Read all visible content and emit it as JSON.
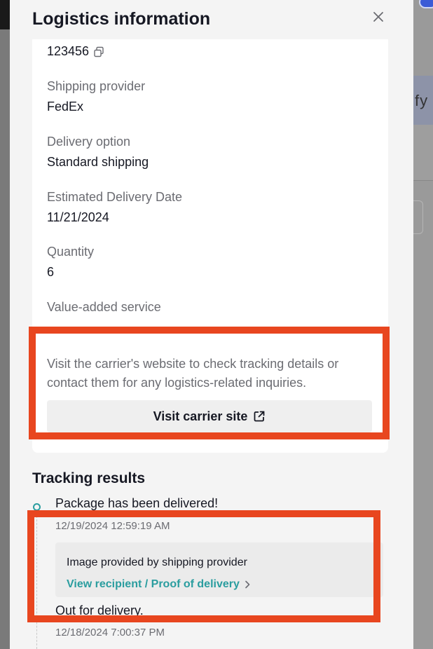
{
  "drawer": {
    "title": "Logistics information",
    "close_icon": "close-icon"
  },
  "info": {
    "tracking_number": "123456",
    "fields": [
      {
        "label": "Shipping provider",
        "value": "FedEx"
      },
      {
        "label": "Delivery option",
        "value": "Standard shipping"
      },
      {
        "label": "Estimated Delivery Date",
        "value": "11/21/2024"
      },
      {
        "label": "Quantity",
        "value": "6"
      },
      {
        "label": "Value-added service",
        "value": ""
      }
    ],
    "carrier_note": "Visit the carrier's website to check tracking details or contact them for any logistics-related inquiries.",
    "visit_button": "Visit carrier site",
    "visit_icon": "external-link-icon",
    "copy_icon": "copy-icon"
  },
  "tracking": {
    "title": "Tracking results",
    "events": [
      {
        "title": "Package has been delivered!",
        "time": "12/19/2024 12:59:19 AM"
      },
      {
        "title": "Out for delivery.",
        "time": "12/18/2024 7:00:37 PM"
      }
    ],
    "proof": {
      "label": "Image provided by shipping provider",
      "link": "View recipient / Proof of delivery"
    }
  },
  "background": {
    "partial_text": "fy"
  },
  "colors": {
    "accent": "#2a9d9f",
    "highlight": "#e8461f"
  }
}
